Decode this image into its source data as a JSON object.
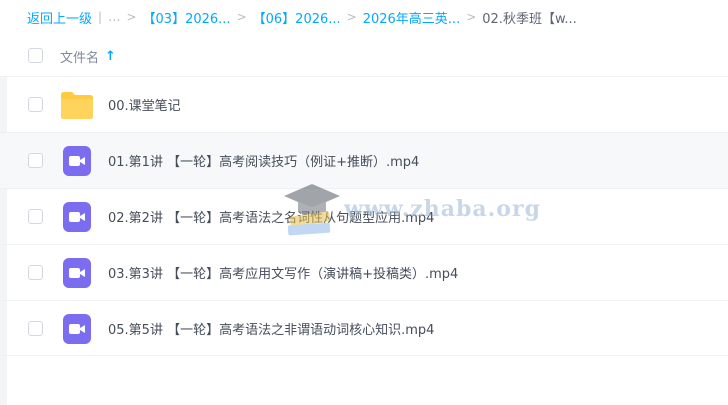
{
  "breadcrumb": {
    "back": "返回上一级",
    "sep": "|",
    "ellipsis": "...",
    "arrow": ">",
    "items": [
      "【03】2026...",
      "【06】2026...",
      "2026年高三英..."
    ],
    "current": "02.秋季班【w..."
  },
  "header": {
    "column_name": "文件名",
    "sort_icon": "↑"
  },
  "files": [
    {
      "name": "00.课堂笔记",
      "type": "folder-icon"
    },
    {
      "name": "01.第1讲 【一轮】高考阅读技巧（例证+推断）.mp4",
      "type": "video-icon"
    },
    {
      "name": "02.第2讲 【一轮】高考语法之名词性从句题型应用.mp4",
      "type": "video-icon"
    },
    {
      "name": "03.第3讲 【一轮】高考应用文写作（演讲稿+投稿类）.mp4",
      "type": "video-icon"
    },
    {
      "name": "05.第5讲 【一轮】高考语法之非谓语动词核心知识.mp4",
      "type": "video-icon"
    }
  ],
  "watermark": {
    "text": "www.zhaba.org"
  },
  "colors": {
    "accent": "#06a7ff",
    "folder": "#ffc940",
    "video": "#7b6cf0"
  }
}
